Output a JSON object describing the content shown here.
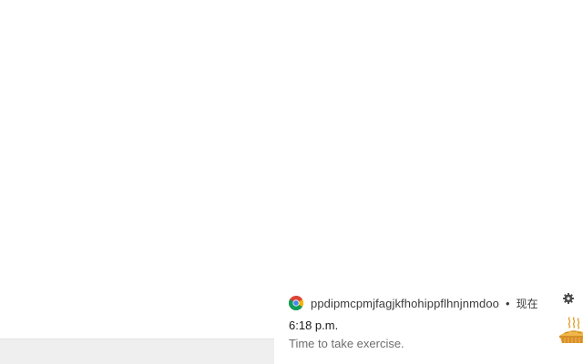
{
  "notification": {
    "app_icon": "chrome-icon",
    "app_name": "ppdipmcpmjfagjkfhohippflhnjnmdoo",
    "separator": "•",
    "time": "现在",
    "settings_icon": "gear-icon",
    "title": "6:18 p.m.",
    "body": "Time to take exercise.",
    "image": "hot-pie-icon"
  },
  "colors": {
    "chrome_red": "#db4437",
    "chrome_green": "#0f9d58",
    "chrome_yellow": "#f4b400",
    "chrome_blue": "#4285f4",
    "pie_crust": "#e0a030",
    "taskbar": "#efefef"
  }
}
